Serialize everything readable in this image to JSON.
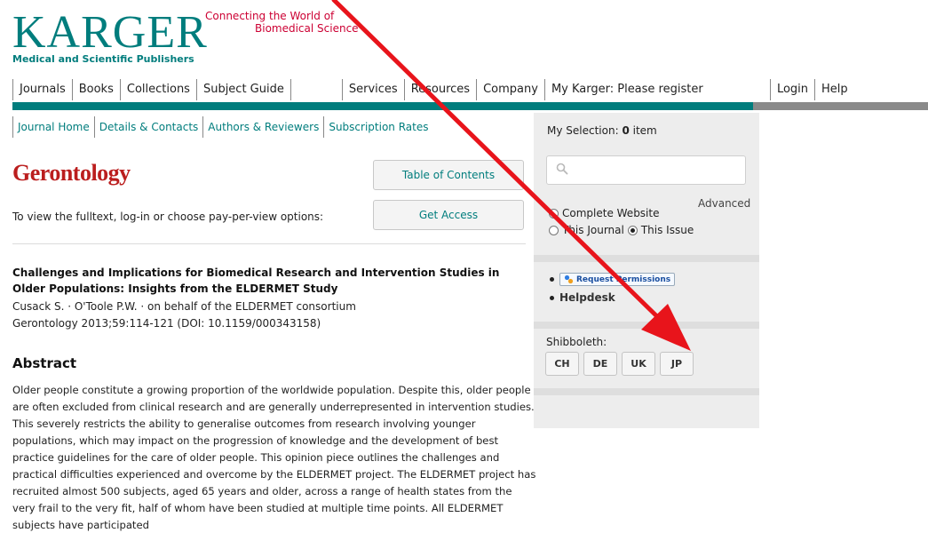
{
  "brand": {
    "logo_text": "KARGER",
    "logo_subtitle": "Medical and Scientific Publishers",
    "tagline_line1": "Connecting the World of",
    "tagline_line2": "Biomedical Science",
    "color_teal": "#007d7d",
    "color_red": "#cc0033"
  },
  "topnav": {
    "journals": "Journals",
    "books": "Books",
    "collections": "Collections",
    "subject_guide": "Subject Guide",
    "services": "Services",
    "resources": "Resources",
    "company": "Company",
    "my_karger": "My Karger: Please register",
    "login": "Login",
    "help": "Help"
  },
  "subnav": {
    "journal_home": "Journal Home",
    "details_contacts": "Details & Contacts",
    "authors_reviewers": "Authors & Reviewers",
    "subscription_rates": "Subscription Rates"
  },
  "journal": {
    "name": "Gerontology",
    "toc_button": "Table of Contents",
    "access_prompt": "To view the fulltext, log-in or choose pay-per-view options:",
    "access_button": "Get Access"
  },
  "article": {
    "title": "Challenges and Implications for Biomedical Research and Intervention Studies in Older Populations: Insights from the ELDERMET Study",
    "authors": "Cusack S. · O'Toole P.W. · on behalf of the ELDERMET consortium",
    "citation": "Gerontology 2013;59:114-121 (DOI: 10.1159/000343158)",
    "abstract_heading": "Abstract",
    "abstract_text": "Older people constitute a growing proportion of the worldwide population. Despite this, older people are often excluded from clinical research and are generally underrepresented in intervention studies. This severely restricts the ability to generalise outcomes from research involving younger populations, which may impact on the progression of knowledge and the development of best practice guidelines for the care of older people. This opinion piece outlines the challenges and practical difficulties experienced and overcome by the ELDERMET project. The ELDERMET project has recruited almost 500 subjects, aged 65 years and older, across a range of health states from the very frail to the very fit, half of whom have been studied at multiple time points. All ELDERMET subjects have participated"
  },
  "sidebar": {
    "selection_prefix": "My Selection: ",
    "selection_count": "0",
    "selection_suffix": " item",
    "search_value": "",
    "advanced": "Advanced",
    "scope_complete": "Complete Website",
    "scope_journal": "This Journal",
    "scope_issue": "This Issue",
    "scope_selected": "This Issue",
    "request_permissions": "Request Permissions",
    "helpdesk": "Helpdesk",
    "shibboleth_label": "Shibboleth:",
    "shibboleth_buttons": [
      "CH",
      "DE",
      "UK",
      "JP"
    ]
  },
  "annotation": {
    "arrow_color": "#e8141b"
  }
}
